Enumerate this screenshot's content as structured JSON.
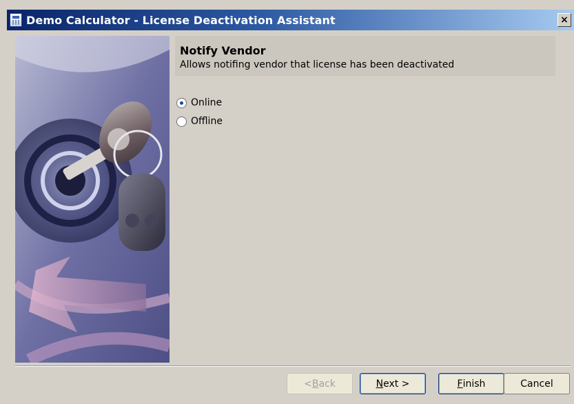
{
  "window": {
    "title": "Demo Calculator - License Deactivation Assistant",
    "close_glyph": "×"
  },
  "header": {
    "title": "Notify Vendor",
    "subtitle": "Allows notifing vendor that license has been deactivated"
  },
  "options": [
    {
      "label": "Online",
      "selected": true
    },
    {
      "label": "Offline",
      "selected": false
    }
  ],
  "buttons": {
    "back": {
      "before": "< ",
      "mnemonic": "B",
      "after": "ack",
      "enabled": false
    },
    "next": {
      "before": "",
      "mnemonic": "N",
      "after": "ext >",
      "enabled": true
    },
    "finish": {
      "before": "",
      "mnemonic": "F",
      "after": "inish",
      "enabled": true
    },
    "cancel": {
      "label": "Cancel",
      "enabled": true
    }
  },
  "icons": {
    "app": "calculator-icon",
    "close": "close-icon",
    "illustration": "keys-lock-illustration"
  },
  "colors": {
    "titlebar_start": "#0a246a",
    "titlebar_end": "#a6caf0",
    "dialog_bg": "#d4d0c8",
    "header_band": "#cbc7bf",
    "radio_dot": "#21449e"
  }
}
